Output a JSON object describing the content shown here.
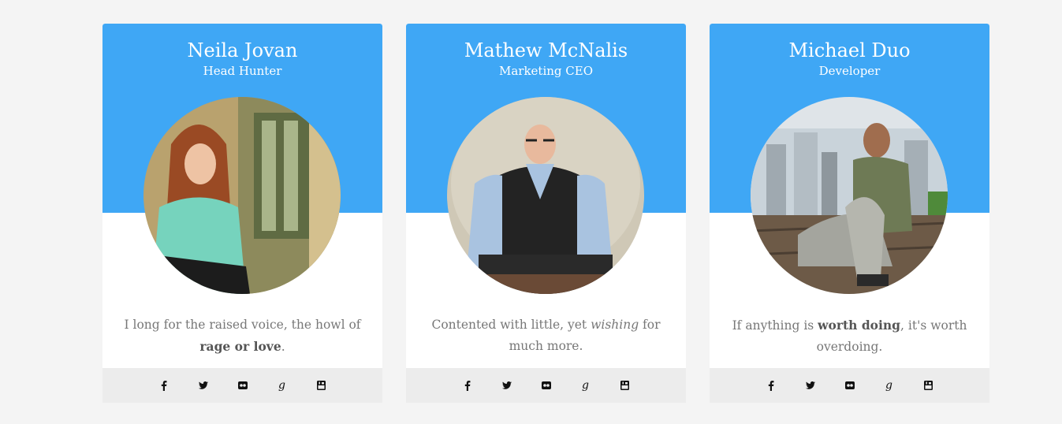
{
  "cards": [
    {
      "name": "Neila Jovan",
      "role": "Head Hunter",
      "quote": {
        "before": "I long for the raised voice, the howl of ",
        "emphasis": "rage or love",
        "after": "."
      },
      "social_icons": [
        "facebook-icon",
        "twitter-icon",
        "flickr-icon",
        "google-plus-icon",
        "youtube-icon"
      ]
    },
    {
      "name": "Mathew McNalis",
      "role": "Marketing CEO",
      "quote": {
        "before": "Contented with little, yet ",
        "emphasis": "wishing",
        "after": " for much more."
      },
      "social_icons": [
        "facebook-icon",
        "twitter-icon",
        "flickr-icon",
        "google-plus-icon",
        "youtube-icon"
      ]
    },
    {
      "name": "Michael Duo",
      "role": "Developer",
      "quote": {
        "before": "If anything is ",
        "emphasis": "worth doing",
        "after": ", it's worth overdoing."
      },
      "social_icons": [
        "facebook-icon",
        "twitter-icon",
        "flickr-icon",
        "google-plus-icon",
        "youtube-icon"
      ]
    }
  ],
  "colors": {
    "accent": "#3fa7f5",
    "page_bg": "#f4f4f4",
    "footer_bg": "#ececec",
    "text": "#777777"
  }
}
